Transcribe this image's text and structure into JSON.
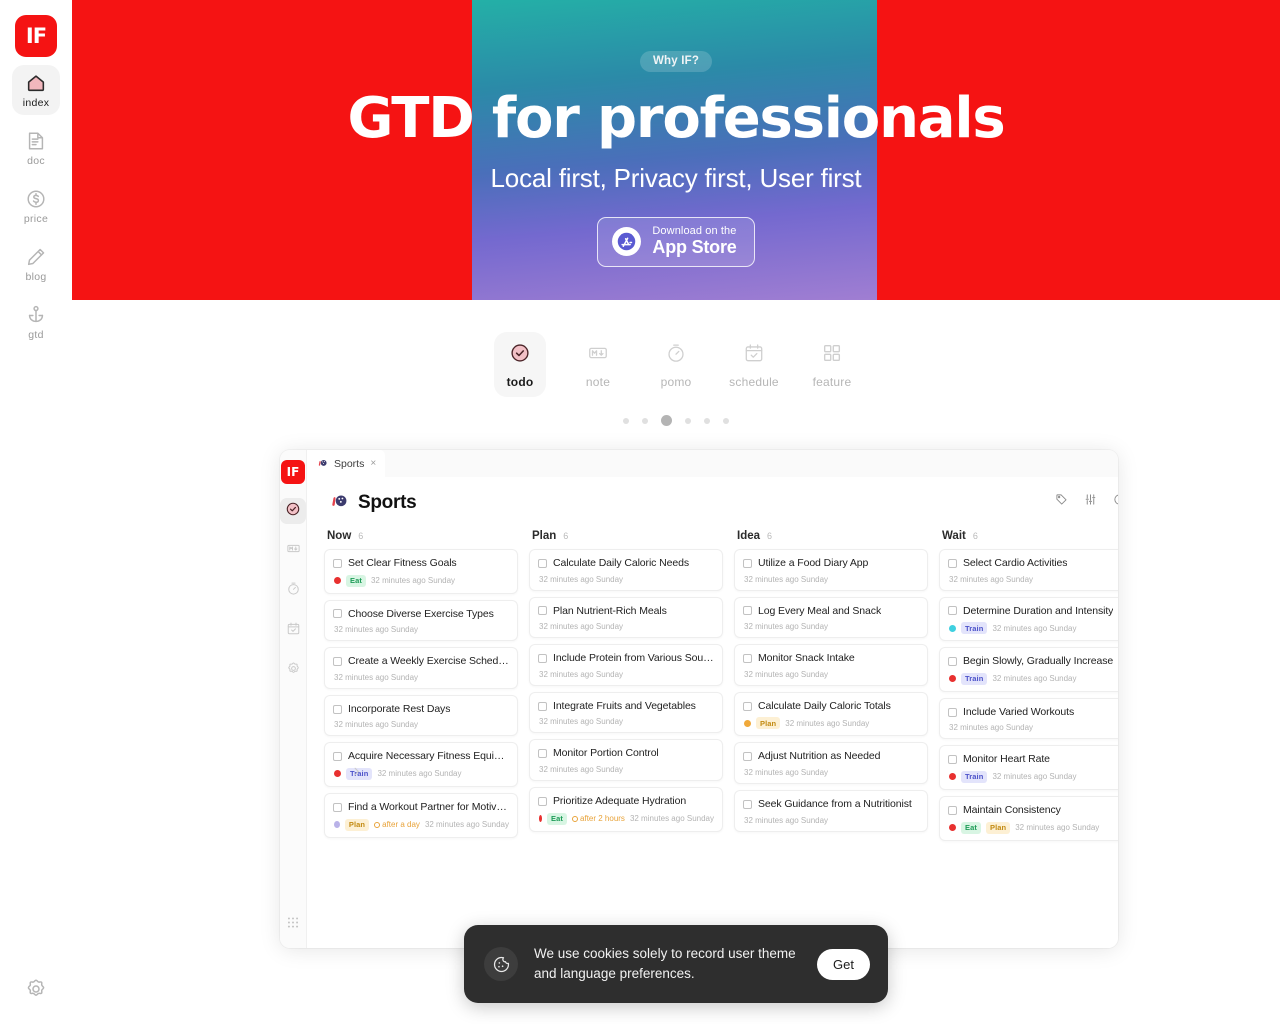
{
  "brand": {
    "logo_text": "IF",
    "accent": "#f51313"
  },
  "left_rail": {
    "items": [
      {
        "label": "index",
        "icon": "home-icon",
        "active": true
      },
      {
        "label": "doc",
        "icon": "document-icon",
        "active": false
      },
      {
        "label": "price",
        "icon": "dollar-circle-icon",
        "active": false
      },
      {
        "label": "blog",
        "icon": "pencil-icon",
        "active": false
      },
      {
        "label": "gtd",
        "icon": "anchor-icon",
        "active": false
      }
    ],
    "settings_icon": "gear-icon"
  },
  "hero": {
    "badge": "Why IF?",
    "title": "GTD for professionals",
    "subtitle": "Local first, Privacy first, User first",
    "cta": {
      "small": "Download on the",
      "big": "App Store",
      "icon": "apple-appstore-icon"
    },
    "background_color": "#f51313",
    "gradient_from": "#24b0a7",
    "gradient_to": "#a07ed2"
  },
  "feature_tabs": {
    "items": [
      {
        "label": "todo",
        "icon": "check-circle-icon",
        "active": true
      },
      {
        "label": "note",
        "icon": "markdown-icon",
        "active": false
      },
      {
        "label": "pomo",
        "icon": "timer-icon",
        "active": false
      },
      {
        "label": "schedule",
        "icon": "calendar-check-icon",
        "active": false
      },
      {
        "label": "feature",
        "icon": "grid-icon",
        "active": false
      }
    ],
    "dots": {
      "count": 6,
      "active_index": 2
    }
  },
  "app": {
    "rail": {
      "logo_text": "IF",
      "items": [
        {
          "icon": "check-circle-icon",
          "active": true
        },
        {
          "icon": "markdown-icon",
          "active": false
        },
        {
          "icon": "timer-icon",
          "active": false
        },
        {
          "icon": "calendar-check-icon",
          "active": false
        },
        {
          "icon": "gear-icon",
          "active": false
        }
      ],
      "handle_icon": "grid-dots-icon"
    },
    "tab": {
      "label": "Sports",
      "icon": "bowling-icon",
      "close": "×"
    },
    "header": {
      "title": "Sports",
      "icon": "bowling-icon"
    },
    "header_icons": [
      {
        "icon": "tag-icon"
      },
      {
        "icon": "filter-sliders-icon"
      },
      {
        "icon": "info-circle-icon"
      }
    ],
    "collapse_icon": "chevron-right-icon",
    "timestamp": "32 minutes ago Sunday",
    "columns": [
      {
        "title": "Now",
        "count": "6",
        "cards": [
          {
            "title": "Set Clear Fitness Goals",
            "priority": "#e8302f",
            "tags": [
              "Eat"
            ],
            "repeat": "",
            "time": "32 minutes ago Sunday"
          },
          {
            "title": "Choose Diverse Exercise Types",
            "priority": "",
            "tags": [],
            "repeat": "",
            "time": "32 minutes ago Sunday"
          },
          {
            "title": "Create a Weekly Exercise Schedule",
            "priority": "",
            "tags": [],
            "repeat": "",
            "time": "32 minutes ago Sunday"
          },
          {
            "title": "Incorporate Rest Days",
            "priority": "",
            "tags": [],
            "repeat": "",
            "time": "32 minutes ago Sunday"
          },
          {
            "title": "Acquire Necessary Fitness Equipment",
            "priority": "#e8302f",
            "tags": [
              "Train"
            ],
            "repeat": "",
            "time": "32 minutes ago Sunday"
          },
          {
            "title": "Find a Workout Partner for Motivation",
            "priority": "#b9b2e8",
            "tags": [
              "Plan"
            ],
            "repeat": "after a day",
            "time": "32 minutes ago Sunday"
          }
        ]
      },
      {
        "title": "Plan",
        "count": "6",
        "cards": [
          {
            "title": "Calculate Daily Caloric Needs",
            "priority": "",
            "tags": [],
            "repeat": "",
            "time": "32 minutes ago Sunday"
          },
          {
            "title": "Plan Nutrient-Rich Meals",
            "priority": "",
            "tags": [],
            "repeat": "",
            "time": "32 minutes ago Sunday"
          },
          {
            "title": "Include Protein from Various Sources",
            "priority": "",
            "tags": [],
            "repeat": "",
            "time": "32 minutes ago Sunday"
          },
          {
            "title": "Integrate Fruits and Vegetables",
            "priority": "",
            "tags": [],
            "repeat": "",
            "time": "32 minutes ago Sunday"
          },
          {
            "title": "Monitor Portion Control",
            "priority": "",
            "tags": [],
            "repeat": "",
            "time": "32 minutes ago Sunday"
          },
          {
            "title": "Prioritize Adequate Hydration",
            "priority": "#e8302f",
            "tags": [
              "Eat"
            ],
            "repeat": "after 2 hours",
            "time": "32 minutes ago Sunday"
          }
        ]
      },
      {
        "title": "Idea",
        "count": "6",
        "cards": [
          {
            "title": "Utilize a Food Diary App",
            "priority": "",
            "tags": [],
            "repeat": "",
            "time": "32 minutes ago Sunday"
          },
          {
            "title": "Log Every Meal and Snack",
            "priority": "",
            "tags": [],
            "repeat": "",
            "time": "32 minutes ago Sunday"
          },
          {
            "title": "Monitor Snack Intake",
            "priority": "",
            "tags": [],
            "repeat": "",
            "time": "32 minutes ago Sunday"
          },
          {
            "title": "Calculate Daily Caloric Totals",
            "priority": "#f0a93a",
            "tags": [
              "Plan"
            ],
            "repeat": "",
            "time": "32 minutes ago Sunday"
          },
          {
            "title": "Adjust Nutrition as Needed",
            "priority": "",
            "tags": [],
            "repeat": "",
            "time": "32 minutes ago Sunday"
          },
          {
            "title": "Seek Guidance from a Nutritionist",
            "priority": "",
            "tags": [],
            "repeat": "",
            "time": "32 minutes ago Sunday"
          }
        ]
      },
      {
        "title": "Wait",
        "count": "6",
        "cards": [
          {
            "title": "Select Cardio Activities",
            "priority": "",
            "tags": [],
            "repeat": "",
            "time": "32 minutes ago Sunday"
          },
          {
            "title": "Determine Duration and Intensity",
            "priority": "#3fd0e0",
            "tags": [
              "Train"
            ],
            "repeat": "",
            "time": "32 minutes ago Sunday"
          },
          {
            "title": "Begin Slowly, Gradually Increase",
            "priority": "#e8302f",
            "tags": [
              "Train"
            ],
            "repeat": "",
            "time": "32 minutes ago Sunday"
          },
          {
            "title": "Include Varied Workouts",
            "priority": "",
            "tags": [],
            "repeat": "",
            "time": "32 minutes ago Sunday"
          },
          {
            "title": "Monitor Heart Rate",
            "priority": "#e8302f",
            "tags": [
              "Train"
            ],
            "repeat": "",
            "time": "32 minutes ago Sunday"
          },
          {
            "title": "Maintain Consistency",
            "priority": "#e8302f",
            "tags": [
              "Eat",
              "Plan"
            ],
            "repeat": "",
            "time": "32 minutes ago Sunday"
          }
        ]
      }
    ]
  },
  "cookie_banner": {
    "icon": "cookie-icon",
    "text": "We use cookies solely to record user theme and language preferences.",
    "button": "Get"
  }
}
